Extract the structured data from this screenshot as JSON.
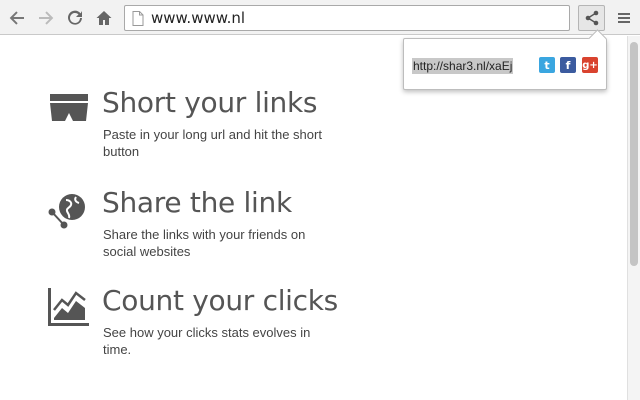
{
  "browser": {
    "url": "www.www.nl",
    "icons": {
      "back": "arrow-left-icon",
      "forward": "arrow-right-icon",
      "reload": "reload-icon",
      "home": "home-icon",
      "page": "page-icon",
      "share": "share-icon",
      "menu": "hamburger-menu-icon"
    }
  },
  "popup": {
    "short_url": "http://shar3.nl/xaEj",
    "social": [
      {
        "name": "twitter",
        "glyph": "t",
        "color": "#3aa6e0"
      },
      {
        "name": "facebook",
        "glyph": "f",
        "color": "#3b5b9f"
      },
      {
        "name": "google-plus",
        "glyph": "g+",
        "color": "#d9432f"
      }
    ]
  },
  "features": [
    {
      "title": "Short your links",
      "desc": "Paste in your long url and hit the short button",
      "icon": "shorts-icon"
    },
    {
      "title": "Share the link",
      "desc": "Share the links with your friends on social websites",
      "icon": "globe-share-icon"
    },
    {
      "title": "Count your clicks",
      "desc": "See how your clicks stats evolves in time.",
      "icon": "chart-icon"
    }
  ],
  "colors": {
    "text": "#555555",
    "twitter": "#3aa6e0",
    "facebook": "#3b5b9f",
    "google": "#d9432f"
  }
}
